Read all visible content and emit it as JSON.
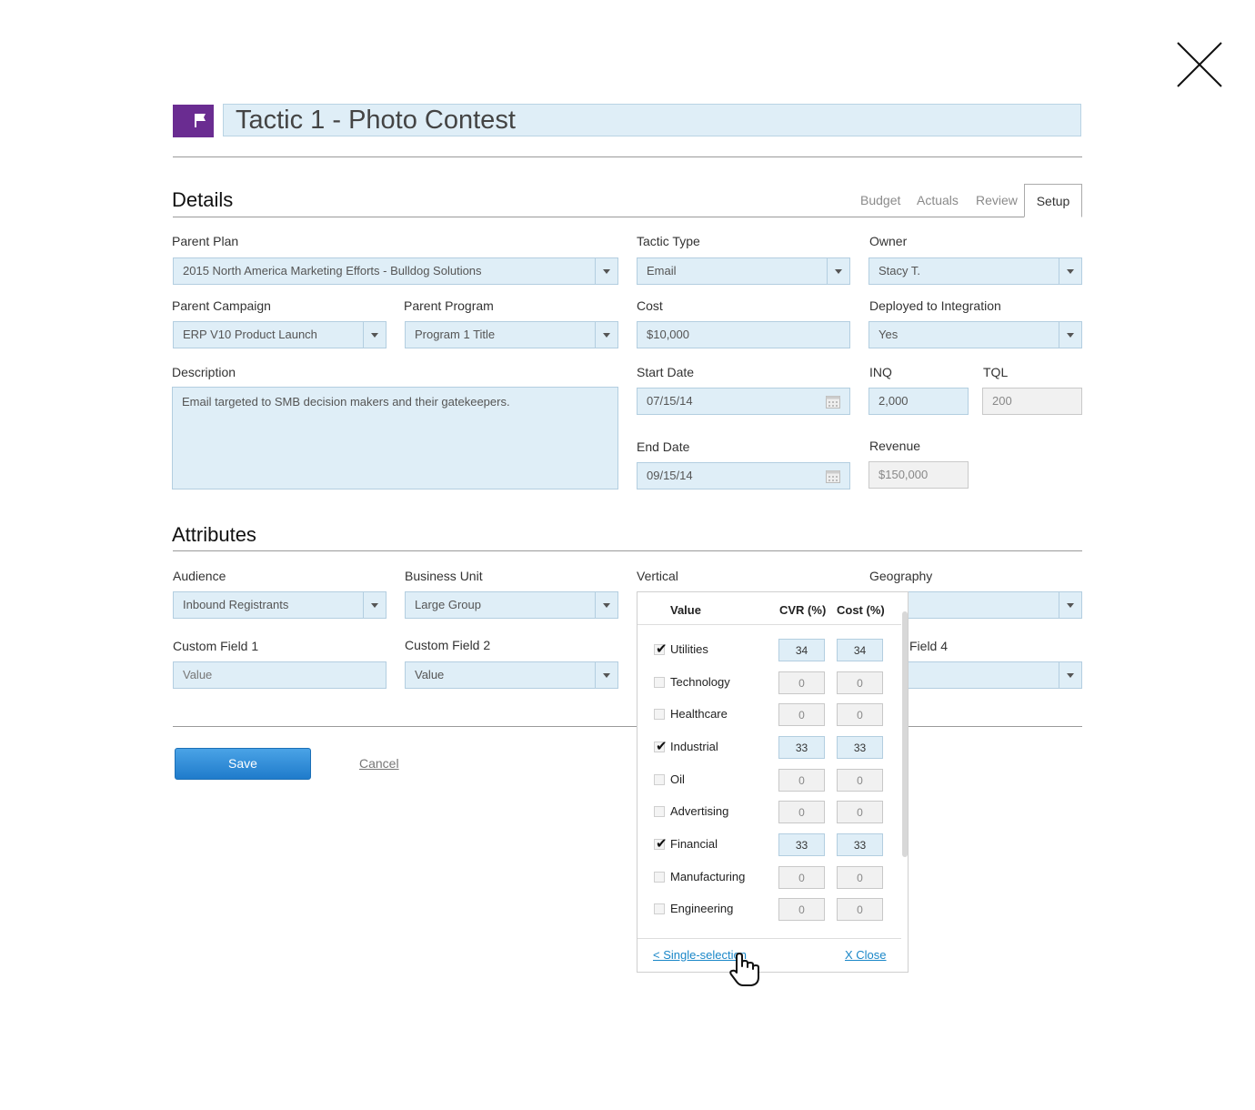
{
  "title": "Tactic 1 - Photo Contest",
  "details": {
    "heading": "Details",
    "tabs": [
      "Budget",
      "Actuals",
      "Review"
    ],
    "active_tab": "Setup",
    "parent_plan": {
      "label": "Parent Plan",
      "value": "2015 North America Marketing Efforts - Bulldog Solutions"
    },
    "tactic_type": {
      "label": "Tactic Type",
      "value": "Email"
    },
    "owner": {
      "label": "Owner",
      "value": "Stacy T."
    },
    "parent_campaign": {
      "label": "Parent Campaign",
      "value": "ERP V10 Product Launch"
    },
    "parent_program": {
      "label": "Parent Program",
      "value": "Program 1 Title"
    },
    "cost": {
      "label": "Cost",
      "value": "$10,000"
    },
    "deployed": {
      "label": "Deployed to Integration",
      "value": "Yes"
    },
    "description": {
      "label": "Description",
      "value": "Email targeted to SMB decision makers and their gatekeepers."
    },
    "start_date": {
      "label": "Start Date",
      "value": "07/15/14"
    },
    "end_date": {
      "label": "End Date",
      "value": "09/15/14"
    },
    "inq": {
      "label": "INQ",
      "value": "2,000"
    },
    "tql": {
      "label": "TQL",
      "value": "200"
    },
    "revenue": {
      "label": "Revenue",
      "value": "$150,000"
    }
  },
  "attributes": {
    "heading": "Attributes",
    "audience": {
      "label": "Audience",
      "value": "Inbound Registrants"
    },
    "business_unit": {
      "label": "Business Unit",
      "value": "Large Group"
    },
    "vertical": {
      "label": "Vertical"
    },
    "geography": {
      "label": "Geography"
    },
    "custom1": {
      "label": "Custom Field 1",
      "placeholder": "Value"
    },
    "custom2": {
      "label": "Custom Field 2",
      "value": "Value"
    },
    "custom4": {
      "label": "Field 4"
    }
  },
  "actions": {
    "save": "Save",
    "cancel": "Cancel"
  },
  "vertical_popup": {
    "headers": {
      "value": "Value",
      "cvr": "CVR (%)",
      "cost": "Cost (%)"
    },
    "rows": [
      {
        "label": "Utilities",
        "checked": true,
        "cvr": "34",
        "cost": "34"
      },
      {
        "label": "Technology",
        "checked": false,
        "cvr": "0",
        "cost": "0"
      },
      {
        "label": "Healthcare",
        "checked": false,
        "cvr": "0",
        "cost": "0"
      },
      {
        "label": "Industrial",
        "checked": true,
        "cvr": "33",
        "cost": "33"
      },
      {
        "label": "Oil",
        "checked": false,
        "cvr": "0",
        "cost": "0"
      },
      {
        "label": "Advertising",
        "checked": false,
        "cvr": "0",
        "cost": "0"
      },
      {
        "label": "Financial",
        "checked": true,
        "cvr": "33",
        "cost": "33"
      },
      {
        "label": "Manufacturing",
        "checked": false,
        "cvr": "0",
        "cost": "0"
      },
      {
        "label": "Engineering",
        "checked": false,
        "cvr": "0",
        "cost": "0"
      }
    ],
    "single_selection": "< Single-selection",
    "close": "X Close"
  },
  "colors": {
    "accent": "#6a2c91",
    "field_bg": "#dfeef7",
    "link": "#1a87c8",
    "save": "#2b8ad6"
  },
  "icons": {
    "close": "close-icon",
    "flag": "flag-icon",
    "calendar": "calendar-icon",
    "cursor": "hand-pointer-icon"
  }
}
